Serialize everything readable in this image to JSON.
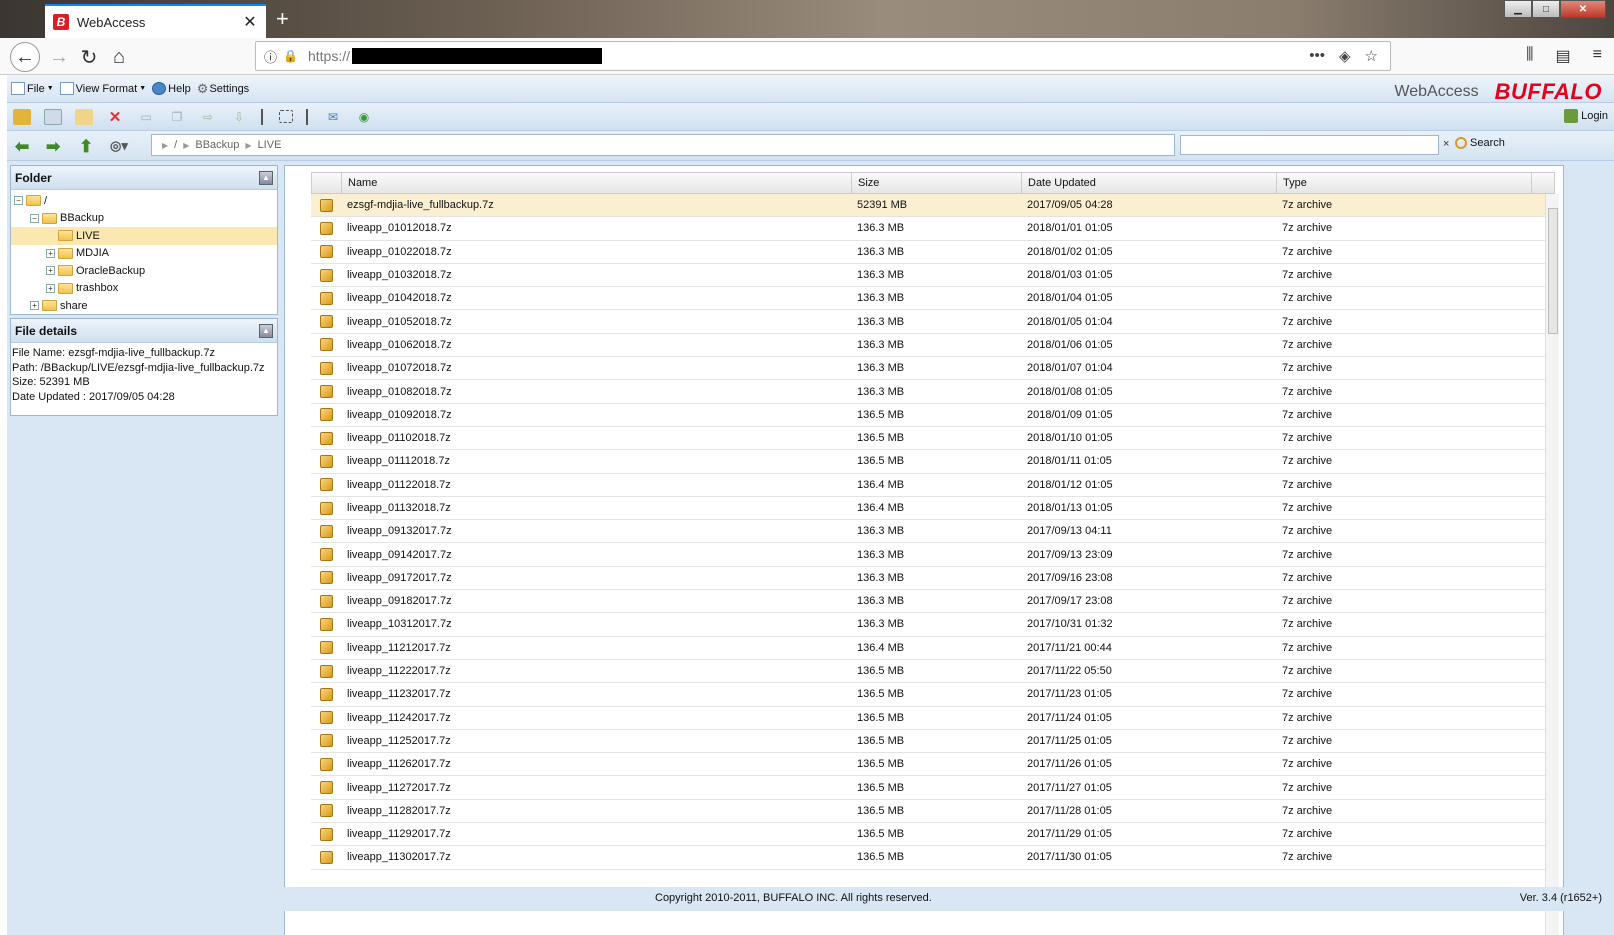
{
  "browser": {
    "tab_title": "WebAccess",
    "tab_favicon": "B",
    "url_prefix": "https://",
    "new_tab": "+",
    "close_tab": "✕"
  },
  "app": {
    "menu": {
      "file": "File",
      "view_format": "View Format",
      "help": "Help",
      "settings": "Settings"
    },
    "brand_text": "WebAccess",
    "brand_logo": "BUFFALO",
    "login": "Login",
    "search_label": "Search",
    "search_clear": "×",
    "path": [
      "/",
      "BBackup",
      "LIVE"
    ]
  },
  "folder_panel": {
    "title": "Folder",
    "tree": [
      {
        "label": "/",
        "level": 0,
        "toggle": "−"
      },
      {
        "label": "BBackup",
        "level": 1,
        "toggle": "−"
      },
      {
        "label": "LIVE",
        "level": 2,
        "toggle": "",
        "selected": true
      },
      {
        "label": "MDJIA",
        "level": 2,
        "toggle": "+"
      },
      {
        "label": "OracleBackup",
        "level": 2,
        "toggle": "+"
      },
      {
        "label": "trashbox",
        "level": 2,
        "toggle": "+"
      },
      {
        "label": "share",
        "level": 1,
        "toggle": "+"
      }
    ]
  },
  "details_panel": {
    "title": "File details",
    "file_name": "File Name: ezsgf-mdjia-live_fullbackup.7z",
    "path": "Path: /BBackup/LIVE/ezsgf-mdjia-live_fullbackup.7z",
    "size": "Size: 52391 MB",
    "date": "Date Updated : 2017/09/05 04:28"
  },
  "table": {
    "headers": {
      "name": "Name",
      "size": "Size",
      "date": "Date Updated",
      "type": "Type"
    },
    "rows": [
      [
        "ezsgf-mdjia-live_fullbackup.7z",
        "52391 MB",
        "2017/09/05 04:28",
        "7z archive"
      ],
      [
        "liveapp_01012018.7z",
        "136.3 MB",
        "2018/01/01 01:05",
        "7z archive"
      ],
      [
        "liveapp_01022018.7z",
        "136.3 MB",
        "2018/01/02 01:05",
        "7z archive"
      ],
      [
        "liveapp_01032018.7z",
        "136.3 MB",
        "2018/01/03 01:05",
        "7z archive"
      ],
      [
        "liveapp_01042018.7z",
        "136.3 MB",
        "2018/01/04 01:05",
        "7z archive"
      ],
      [
        "liveapp_01052018.7z",
        "136.3 MB",
        "2018/01/05 01:04",
        "7z archive"
      ],
      [
        "liveapp_01062018.7z",
        "136.3 MB",
        "2018/01/06 01:05",
        "7z archive"
      ],
      [
        "liveapp_01072018.7z",
        "136.3 MB",
        "2018/01/07 01:04",
        "7z archive"
      ],
      [
        "liveapp_01082018.7z",
        "136.3 MB",
        "2018/01/08 01:05",
        "7z archive"
      ],
      [
        "liveapp_01092018.7z",
        "136.5 MB",
        "2018/01/09 01:05",
        "7z archive"
      ],
      [
        "liveapp_01102018.7z",
        "136.5 MB",
        "2018/01/10 01:05",
        "7z archive"
      ],
      [
        "liveapp_01112018.7z",
        "136.5 MB",
        "2018/01/11 01:05",
        "7z archive"
      ],
      [
        "liveapp_01122018.7z",
        "136.4 MB",
        "2018/01/12 01:05",
        "7z archive"
      ],
      [
        "liveapp_01132018.7z",
        "136.4 MB",
        "2018/01/13 01:05",
        "7z archive"
      ],
      [
        "liveapp_09132017.7z",
        "136.3 MB",
        "2017/09/13 04:11",
        "7z archive"
      ],
      [
        "liveapp_09142017.7z",
        "136.3 MB",
        "2017/09/13 23:09",
        "7z archive"
      ],
      [
        "liveapp_09172017.7z",
        "136.3 MB",
        "2017/09/16 23:08",
        "7z archive"
      ],
      [
        "liveapp_09182017.7z",
        "136.3 MB",
        "2017/09/17 23:08",
        "7z archive"
      ],
      [
        "liveapp_10312017.7z",
        "136.3 MB",
        "2017/10/31 01:32",
        "7z archive"
      ],
      [
        "liveapp_11212017.7z",
        "136.4 MB",
        "2017/11/21 00:44",
        "7z archive"
      ],
      [
        "liveapp_11222017.7z",
        "136.5 MB",
        "2017/11/22 05:50",
        "7z archive"
      ],
      [
        "liveapp_11232017.7z",
        "136.5 MB",
        "2017/11/23 01:05",
        "7z archive"
      ],
      [
        "liveapp_11242017.7z",
        "136.5 MB",
        "2017/11/24 01:05",
        "7z archive"
      ],
      [
        "liveapp_11252017.7z",
        "136.5 MB",
        "2017/11/25 01:05",
        "7z archive"
      ],
      [
        "liveapp_11262017.7z",
        "136.5 MB",
        "2017/11/26 01:05",
        "7z archive"
      ],
      [
        "liveapp_11272017.7z",
        "136.5 MB",
        "2017/11/27 01:05",
        "7z archive"
      ],
      [
        "liveapp_11282017.7z",
        "136.5 MB",
        "2017/11/28 01:05",
        "7z archive"
      ],
      [
        "liveapp_11292017.7z",
        "136.5 MB",
        "2017/11/29 01:05",
        "7z archive"
      ],
      [
        "liveapp_11302017.7z",
        "136.5 MB",
        "2017/11/30 01:05",
        "7z archive"
      ]
    ]
  },
  "footer": {
    "copyright": "Copyright 2010-2011, BUFFALO INC. All rights reserved.",
    "version": "Ver. 3.4 (r1652+)"
  }
}
